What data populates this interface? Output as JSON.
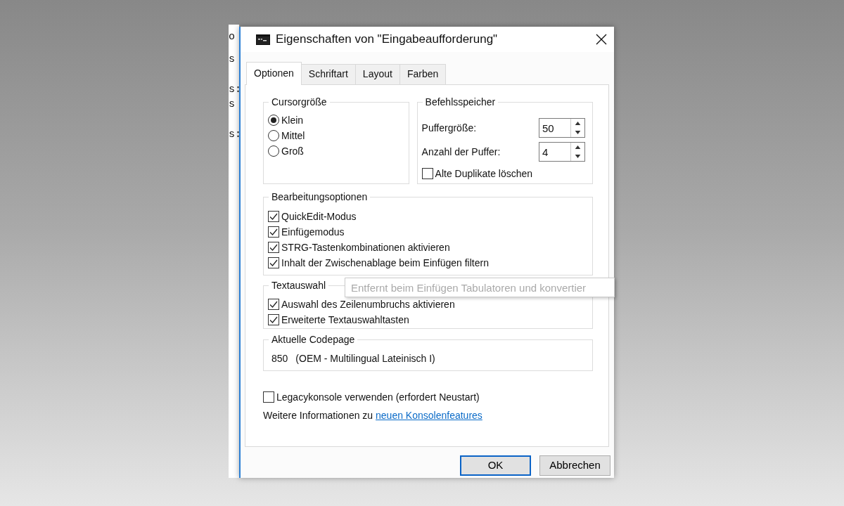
{
  "background_console": {
    "lines": [
      "o",
      "s",
      "s:",
      "s",
      "s:"
    ]
  },
  "window": {
    "title": "Eigenschaften von \"Eingabeaufforderung\""
  },
  "tabs": [
    {
      "label": "Optionen",
      "selected": true
    },
    {
      "label": "Schriftart",
      "selected": false
    },
    {
      "label": "Layout",
      "selected": false
    },
    {
      "label": "Farben",
      "selected": false
    }
  ],
  "cursor_size": {
    "title": "Cursorgröße",
    "options": [
      {
        "label": "Klein",
        "selected": true
      },
      {
        "label": "Mittel",
        "selected": false
      },
      {
        "label": "Groß",
        "selected": false
      }
    ]
  },
  "command_history": {
    "title": "Befehlsspeicher",
    "fields": [
      {
        "label": "Puffergröße:",
        "value": "50"
      },
      {
        "label": "Anzahl der Puffer:",
        "value": "4"
      }
    ],
    "checkbox": {
      "label": "Alte Duplikate löschen",
      "checked": false
    }
  },
  "edit_options": {
    "title": "Bearbeitungsoptionen",
    "items": [
      {
        "label": "QuickEdit-Modus",
        "checked": true
      },
      {
        "label": "Einfügemodus",
        "checked": true
      },
      {
        "label": "STRG-Tastenkombinationen aktivieren",
        "checked": true
      },
      {
        "label": "Inhalt der Zwischenablage beim Einfügen filtern",
        "checked": true
      }
    ]
  },
  "text_selection": {
    "title": "Textauswahl",
    "items": [
      {
        "label": "Auswahl des Zeilenumbruchs aktivieren",
        "checked": true
      },
      {
        "label": "Erweiterte Textauswahltasten",
        "checked": true
      }
    ]
  },
  "codepage": {
    "title": "Aktuelle Codepage",
    "number": "850",
    "name": "(OEM - Multilingual Lateinisch I)"
  },
  "legacy": {
    "label": "Legacykonsole verwenden (erfordert Neustart)",
    "checked": false
  },
  "info": {
    "text": "Weitere Informationen zu",
    "link": "neuen Konsolenfeatures"
  },
  "tooltip": {
    "text": "Entfernt beim Einfügen Tabulatoren und konvertier"
  },
  "buttons": [
    {
      "label": "OK",
      "default": true
    },
    {
      "label": "Abbrechen",
      "default": false
    }
  ]
}
